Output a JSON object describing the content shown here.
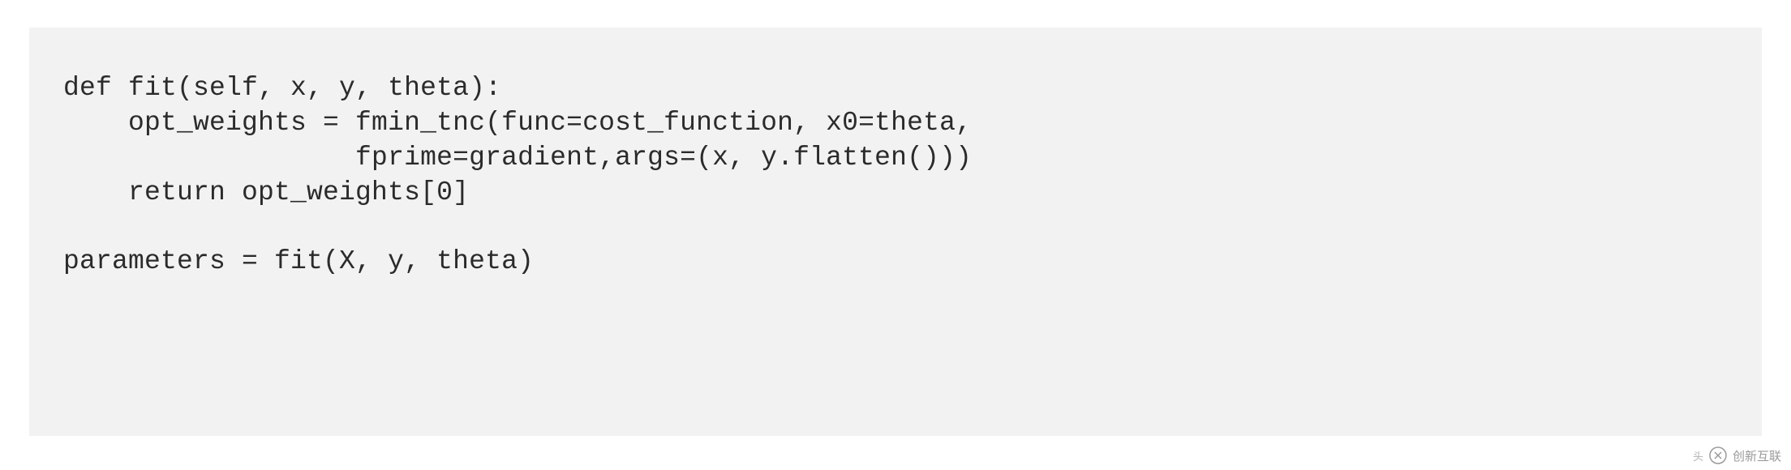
{
  "code": {
    "line1": "def fit(self, x, y, theta):",
    "line2": "    opt_weights = fmin_tnc(func=cost_function, x0=theta,",
    "line3": "                  fprime=gradient,args=(x, y.flatten()))",
    "line4": "    return opt_weights[0]",
    "line5": "",
    "line6": "parameters = fit(X, y, theta)"
  },
  "watermark": {
    "text": "创新互联",
    "mark": "头"
  }
}
